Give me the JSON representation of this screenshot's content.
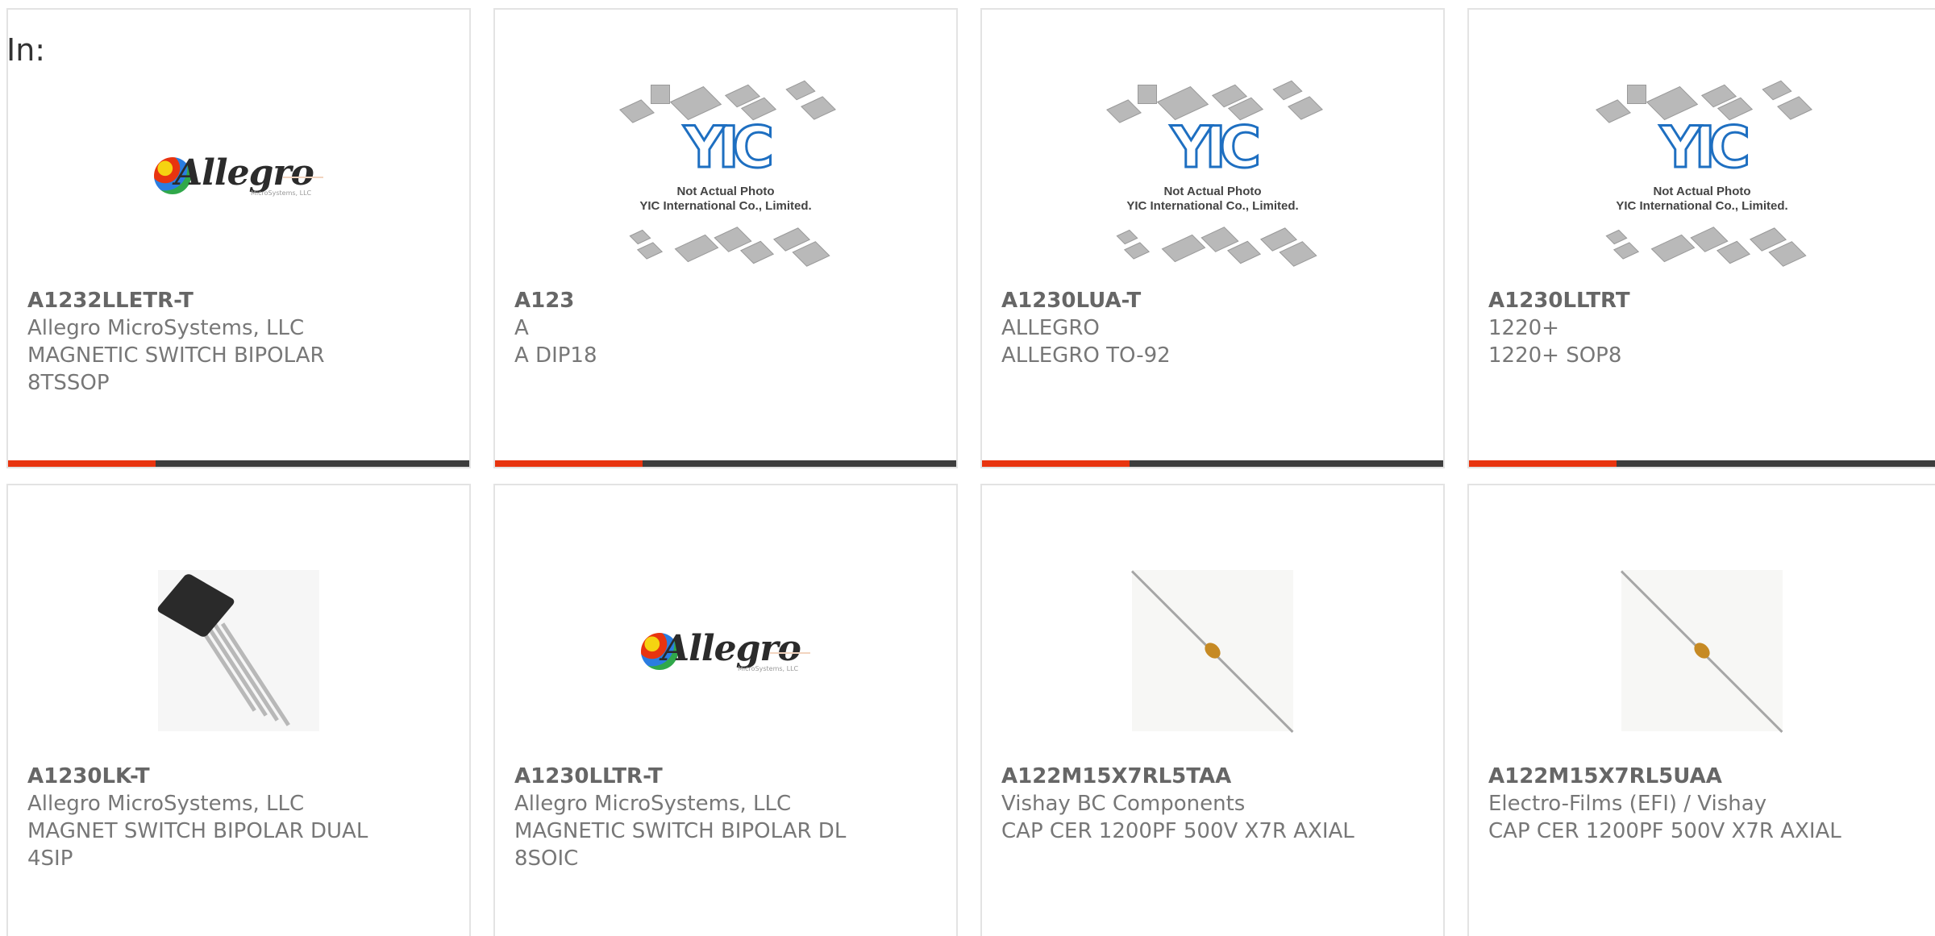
{
  "header": {
    "in_label": "In:"
  },
  "placeholder_caption": {
    "line1": "Not Actual Photo",
    "line2": "YIC International Co., Limited."
  },
  "logos": {
    "allegro_word": "Allegro",
    "allegro_sub": "MicroSystems, LLC",
    "yic_word": "YIC"
  },
  "colors": {
    "accent": "#e8340f",
    "bar": "#3d3d3d",
    "text": "#777777"
  },
  "cards": [
    {
      "part_number": "A1232LLETR-T",
      "manufacturer": "Allegro MicroSystems, LLC",
      "description": "MAGNETIC SWITCH BIPOLAR 8TSSOP",
      "image": "allegro-logo"
    },
    {
      "part_number": "A123",
      "manufacturer": "A",
      "description": "A DIP18",
      "image": "yic-placeholder"
    },
    {
      "part_number": "A1230LUA-T",
      "manufacturer": "ALLEGRO",
      "description": "ALLEGRO TO-92",
      "image": "yic-placeholder"
    },
    {
      "part_number": "A1230LLTRT",
      "manufacturer": "1220+",
      "description": "1220+ SOP8",
      "image": "yic-placeholder"
    },
    {
      "part_number": "A1230LK-T",
      "manufacturer": "Allegro MicroSystems, LLC",
      "description": "MAGNET SWITCH BIPOLAR DUAL 4SIP",
      "image": "sip-component-photo"
    },
    {
      "part_number": "A1230LLTR-T",
      "manufacturer": "Allegro MicroSystems, LLC",
      "description": "MAGNETIC SWITCH BIPOLAR DL 8SOIC",
      "image": "allegro-logo"
    },
    {
      "part_number": "A122M15X7RL5TAA",
      "manufacturer": "Vishay BC Components",
      "description": "CAP CER 1200PF 500V X7R AXIAL",
      "image": "axial-capacitor-photo"
    },
    {
      "part_number": "A122M15X7RL5UAA",
      "manufacturer": "Electro-Films (EFI) / Vishay",
      "description": "CAP CER 1200PF 500V X7R AXIAL",
      "image": "axial-capacitor-photo"
    }
  ]
}
